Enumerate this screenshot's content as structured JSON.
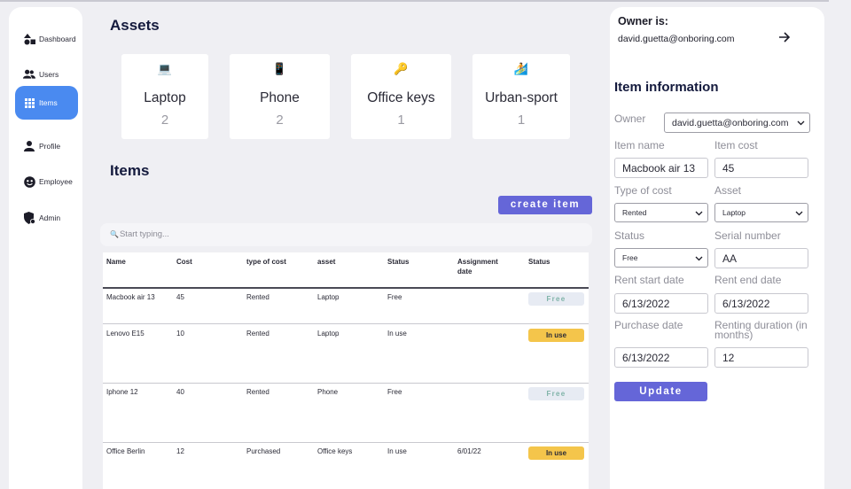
{
  "sidebar": {
    "items": [
      {
        "label": "Dashboard",
        "icon": "shapes-icon"
      },
      {
        "label": "Users",
        "icon": "users-icon"
      },
      {
        "label": "Items",
        "icon": "grid-icon",
        "active": true
      },
      {
        "label": "Profile",
        "icon": "person-icon"
      },
      {
        "label": "Employee",
        "icon": "face-icon"
      },
      {
        "label": "Admin",
        "icon": "shield-icon"
      }
    ]
  },
  "assets": {
    "title": "Assets",
    "cards": [
      {
        "emoji": "💻",
        "name": "Laptop",
        "count": "2"
      },
      {
        "emoji": "📱",
        "name": "Phone",
        "count": "2"
      },
      {
        "emoji": "🔑",
        "name": "Office keys",
        "count": "1"
      },
      {
        "emoji": "🏄",
        "name": "Urban-sport",
        "count": "1"
      }
    ]
  },
  "items": {
    "title": "Items",
    "create_label": "create item",
    "search_placeholder": "Start typing...",
    "columns": [
      "Name",
      "Cost",
      "type of cost",
      "asset",
      "Status",
      "Assignment date",
      "Status"
    ],
    "rows": [
      {
        "name": "Macbook air 13",
        "cost": "45",
        "type": "Rented",
        "asset": "Laptop",
        "status": "Free",
        "date": "",
        "badge": "Free"
      },
      {
        "name": "Lenovo E15",
        "cost": "10",
        "type": "Rented",
        "asset": "Laptop",
        "status": "In use",
        "date": "",
        "badge": "In use"
      },
      {
        "name": "Iphone 12",
        "cost": "40",
        "type": "Rented",
        "asset": "Phone",
        "status": "Free",
        "date": "",
        "badge": "Free"
      },
      {
        "name": "Office Berlin",
        "cost": "12",
        "type": "Purchased",
        "asset": "Office keys",
        "status": "In use",
        "date": "6/01/22",
        "badge": "In use"
      }
    ]
  },
  "panel": {
    "owner_heading": "Owner is:",
    "owner_email": "david.guetta@onboring.com",
    "info_title": "Item information",
    "owner_label": "Owner",
    "owner_value": "david.guetta@onboring.com",
    "item_name_label": "Item name",
    "item_name_value": "Macbook air 13",
    "item_cost_label": "Item cost",
    "item_cost_value": "45",
    "type_of_cost_label": "Type of cost",
    "type_of_cost_value": "Rented",
    "asset_label": "Asset",
    "asset_value": "Laptop",
    "status_label": "Status",
    "status_value": "Free",
    "serial_label": "Serial number",
    "serial_value": "AA",
    "rent_start_label": "Rent start date",
    "rent_start_value": "6/13/2022",
    "rent_end_label": "Rent end date",
    "rent_end_value": "6/13/2022",
    "purchase_label": "Purchase date",
    "purchase_value": "6/13/2022",
    "duration_label": "Renting duration (in months)",
    "duration_value": "12",
    "update_label": "Update"
  },
  "colors": {
    "accent": "#6566d8",
    "sidebar_active": "#4a8af0",
    "badge_in_use": "#f4c54b",
    "badge_free": "#e7ebf3"
  }
}
